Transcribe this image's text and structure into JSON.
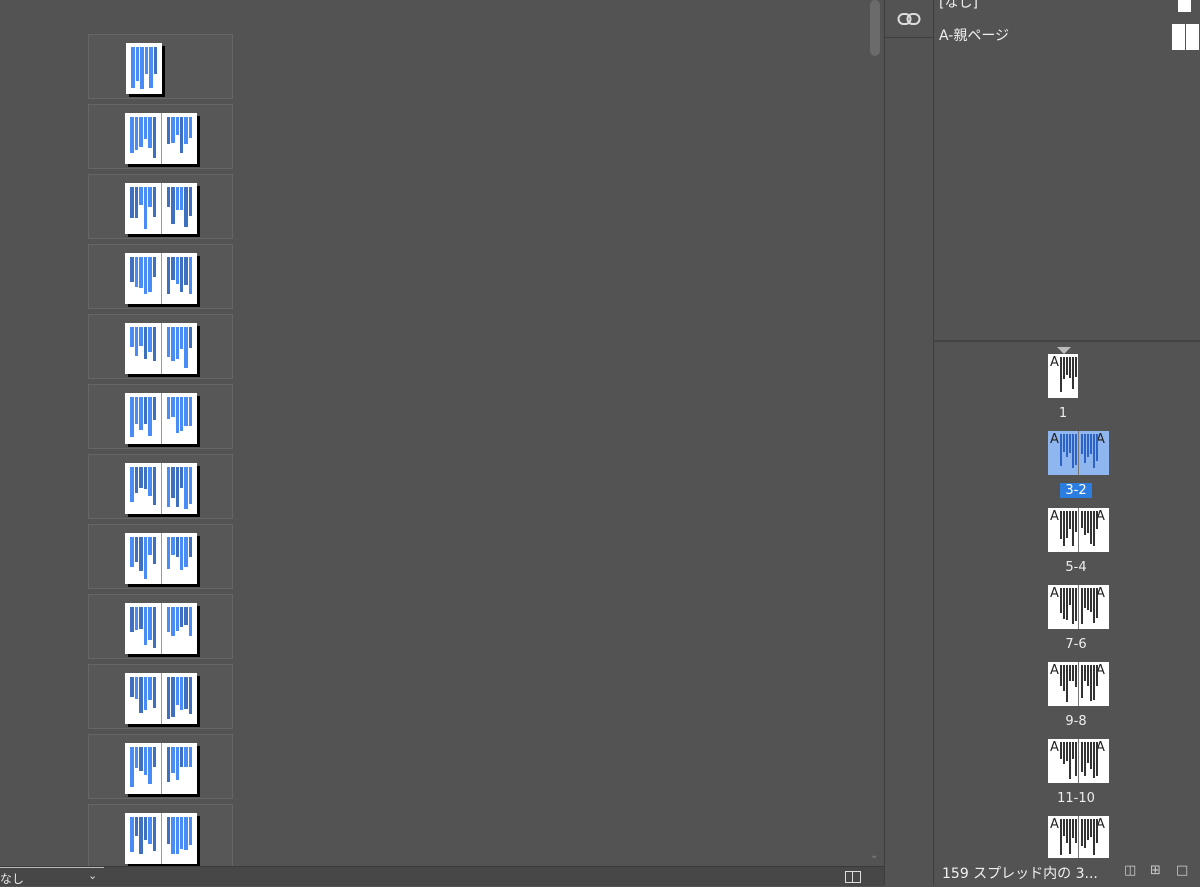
{
  "canvas": {
    "spreads": [
      {
        "type": "single"
      },
      {
        "type": "pair"
      },
      {
        "type": "pair"
      },
      {
        "type": "pair"
      },
      {
        "type": "pair"
      },
      {
        "type": "pair"
      },
      {
        "type": "pair"
      },
      {
        "type": "pair"
      },
      {
        "type": "pair"
      },
      {
        "type": "pair"
      },
      {
        "type": "pair"
      },
      {
        "type": "pair"
      }
    ]
  },
  "bottom_bar": {
    "zoom_label": "なし"
  },
  "icon_strip": {
    "links_icon": "link-icon"
  },
  "pages_panel": {
    "parents": [
      {
        "label": "[なし]"
      },
      {
        "label": "A-親ページ"
      }
    ],
    "spreads": [
      {
        "label": "1",
        "left": "",
        "right": "A",
        "selected": false
      },
      {
        "label": "3-2",
        "left": "A",
        "right": "A",
        "selected": true
      },
      {
        "label": "5-4",
        "left": "A",
        "right": "A",
        "selected": false
      },
      {
        "label": "7-6",
        "left": "A",
        "right": "A",
        "selected": false
      },
      {
        "label": "9-8",
        "left": "A",
        "right": "A",
        "selected": false
      },
      {
        "label": "11-10",
        "left": "A",
        "right": "A",
        "selected": false
      },
      {
        "label": "",
        "left": "A",
        "right": "A",
        "selected": false
      }
    ],
    "footer": {
      "status": "159 スプレッド内の 3...",
      "icons": [
        "edit-page-size-icon",
        "new-page-icon",
        "delete-page-icon"
      ]
    },
    "colors": {
      "selection": "#2b7de0",
      "page_content": "#4a8cf6"
    }
  }
}
